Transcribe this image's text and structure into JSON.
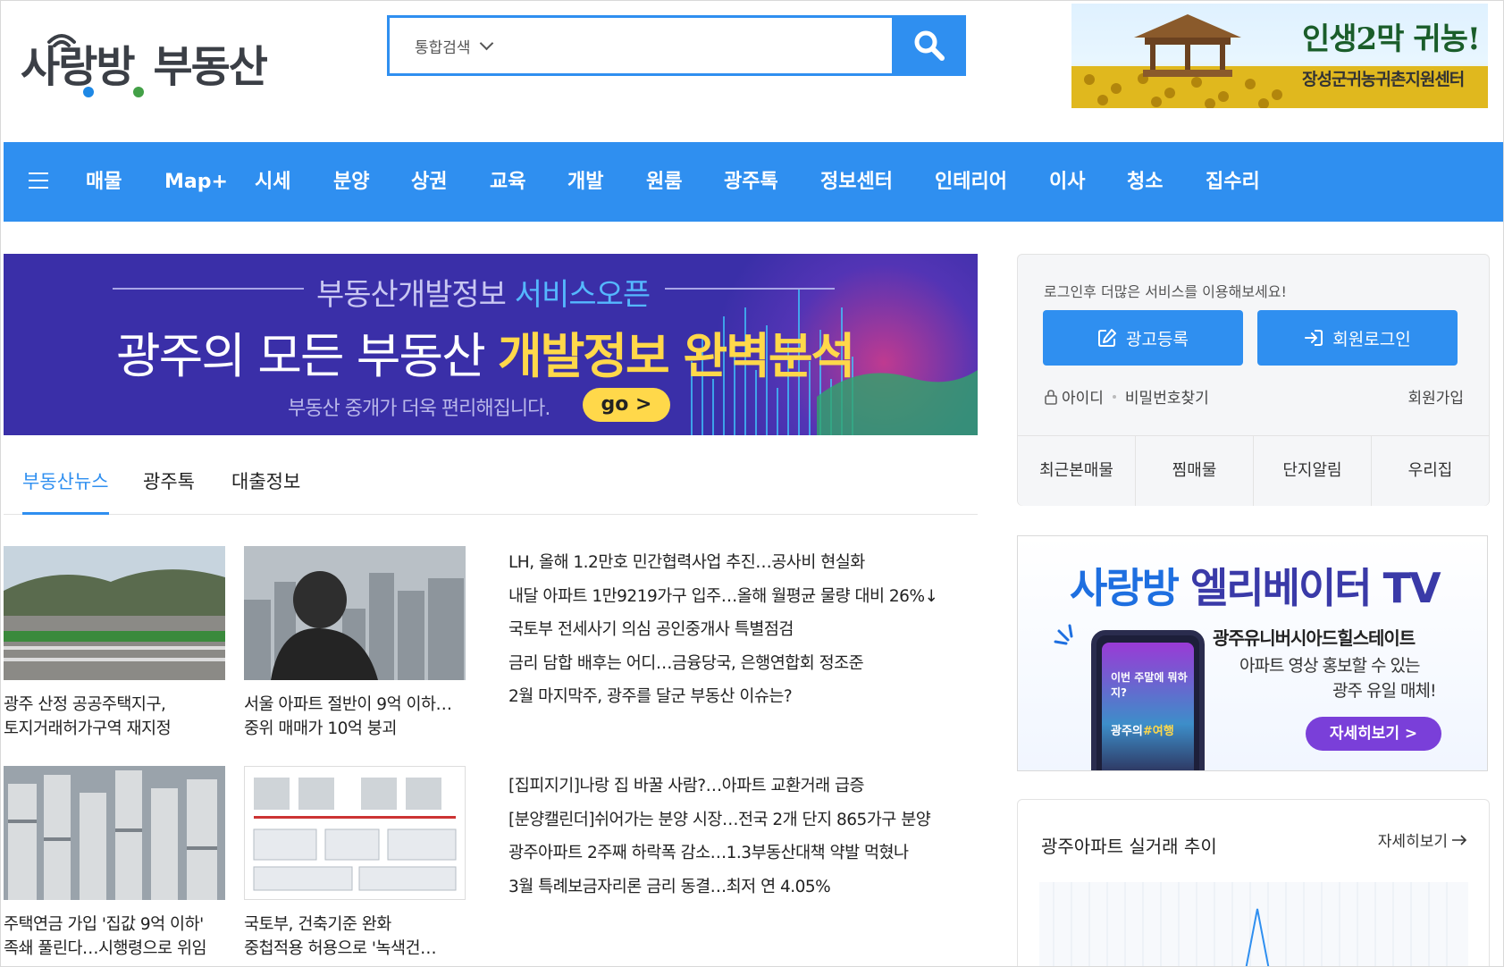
{
  "header": {
    "logo_brand": "사랑방",
    "logo_sub": "부동산",
    "search_select": "통합검색",
    "search_placeholder": "",
    "top_ad_line1": "인생2막 귀농!",
    "top_ad_line2": "장성군귀농귀촌지원센터"
  },
  "nav": {
    "items": [
      "매물",
      "Map+",
      "시세",
      "분양",
      "상권",
      "교육",
      "개발",
      "원룸",
      "광주톡",
      "정보센터",
      "인테리어",
      "이사",
      "청소",
      "집수리"
    ]
  },
  "hero": {
    "top_a": "부동산개발정보",
    "top_b": "서비스오픈",
    "main_a": "광주의 모든 부동산",
    "main_b": "개발정보 완벽분석",
    "sub": "부동산 중개가 더욱 편리해집니다.",
    "go": "go >"
  },
  "tabs": [
    "부동산뉴스",
    "광주톡",
    "대출정보"
  ],
  "news": {
    "row1_caps": [
      [
        "광주 산정 공공주택지구,",
        "토지거래허가구역 재지정"
      ],
      [
        "서울 아파트 절반이 9억 이하…",
        "중위 매매가 10억 붕괴"
      ]
    ],
    "row1_headlines": [
      "LH, 올해 1.2만호 민간협력사업 추진…공사비 현실화",
      "내달 아파트 1만9219가구 입주…올해 월평균 물량 대비 26%↓",
      "국토부 전세사기 의심 공인중개사 특별점검",
      "금리 담합 배후는 어디…금융당국, 은행연합회 정조준",
      "2월 마지막주, 광주를 달군 부동산 이슈는?"
    ],
    "row2_caps": [
      [
        "주택연금 가입 '집값 9억 이하'",
        "족쇄 풀린다…시행령으로 위임"
      ],
      [
        "국토부, 건축기준 완화",
        "중첩적용 허용으로 '녹색건…"
      ]
    ],
    "row2_headlines": [
      "[집피지기]나랑 집 바꿀 사람?…아파트 교환거래 급증",
      "[분양캘린더]쉬어가는 분양 시장…전국 2개 단지 865가구 분양",
      "광주아파트 2주째 하락폭 감소…1.3부동산대책 약발 먹혔나",
      "3월 특례보금자리론 금리 동결…최저 연 4.05%"
    ]
  },
  "login": {
    "message": "로그인후 더많은 서비스를 이용해보세요!",
    "ad_button": "광고등록",
    "login_button": "회원로그인",
    "id_link": "아이디",
    "pw_link": "비밀번호찾기",
    "join": "회원가입",
    "quick": [
      "최근본매물",
      "찜매물",
      "단지알림",
      "우리집"
    ]
  },
  "elevator_ad": {
    "title_a": "사랑방",
    "title_b": "엘리베이터 TV",
    "line1": "광주유니버시아드힐스테이트",
    "line2": "아파트 영상 홍보할 수 있는",
    "line3": "광주 유일 매체!",
    "button": "자세히보기 >",
    "phone_a": "이번 주말에 뭐하지?",
    "phone_b1": "광주의",
    "phone_b2": "#여행"
  },
  "trend": {
    "title": "광주아파트 실거래 추이",
    "more": "자세히보기"
  },
  "colors": {
    "primary": "#2f8ff0",
    "hero_bg": "#3a2fa8",
    "hero_highlight": "#ffd84a",
    "elevator_button": "#7a3fd9"
  }
}
